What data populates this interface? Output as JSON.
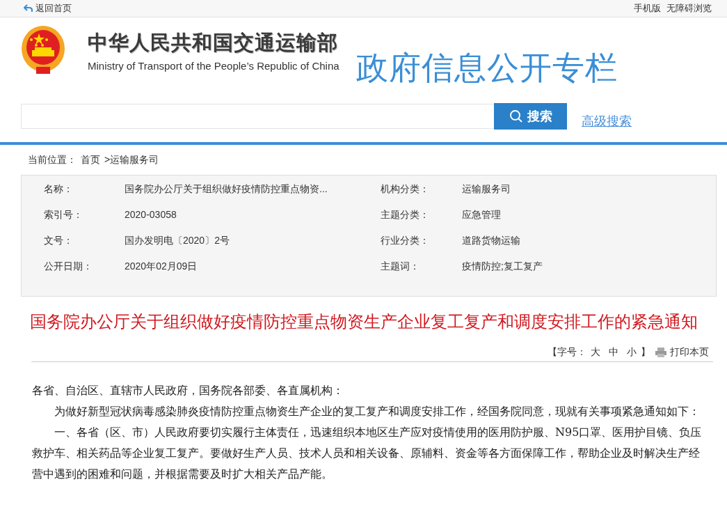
{
  "top_bar": {
    "back_link": "返回首页",
    "links": [
      "手机版",
      "无障碍浏览"
    ]
  },
  "header": {
    "name_cn": "中华人民共和国交通运输部",
    "name_en": "Ministry of Transport of the People’s Republic of China",
    "section_title": "政府信息公开专栏"
  },
  "search": {
    "button": "搜索",
    "advanced_link": "高级搜索"
  },
  "breadcrumb": {
    "label": "当前位置：",
    "items": [
      "首页",
      ">运输服务司"
    ]
  },
  "info": [
    {
      "label": "名称：",
      "value": "国务院办公厅关于组织做好疫情防控重点物资...",
      "label_2": "机构分类：",
      "value_2": "运输服务司"
    },
    {
      "label": "索引号：",
      "value": "2020-03058",
      "label_2": "主题分类：",
      "value_2": "应急管理"
    },
    {
      "label": "文号：",
      "value": "国办发明电〔2020〕2号",
      "label_2": "行业分类：",
      "value_2": "道路货物运输"
    },
    {
      "label": "公开日期：",
      "value": "2020年02月09日",
      "label_2": "主题词：",
      "value_2": "疫情防控;复工复产"
    }
  ],
  "article": {
    "title": "国务院办公厅关于组织做好疫情防控重点物资生产企业复工复产和调度安排工作的紧急通知",
    "font_size": {
      "open": "【字号：",
      "options": [
        "大",
        "中",
        "小"
      ],
      "close": "】"
    },
    "print": "打印本页",
    "paragraphs": [
      {
        "indent": false,
        "text": "各省、自治区、直辖市人民政府，国务院各部委、各直属机构："
      },
      {
        "indent": true,
        "text": "为做好新型冠状病毒感染肺炎疫情防控重点物资生产企业的复工复产和调度安排工作，经国务院同意，现就有关事项紧急通知如下："
      },
      {
        "indent": true,
        "text": "一、各省（区、市）人民政府要切实履行主体责任，迅速组织本地区生产应对疫情使用的医用防护服、N95口罩、医用护目镜、负压救护车、相关药品等企业复工复产。要做好生产人员、技术人员和相关设备、原辅料、资金等各方面保障工作，帮助企业及时解决生产经营中遇到的困难和问题，并根据需要及时扩大相关产品产能。"
      }
    ]
  }
}
